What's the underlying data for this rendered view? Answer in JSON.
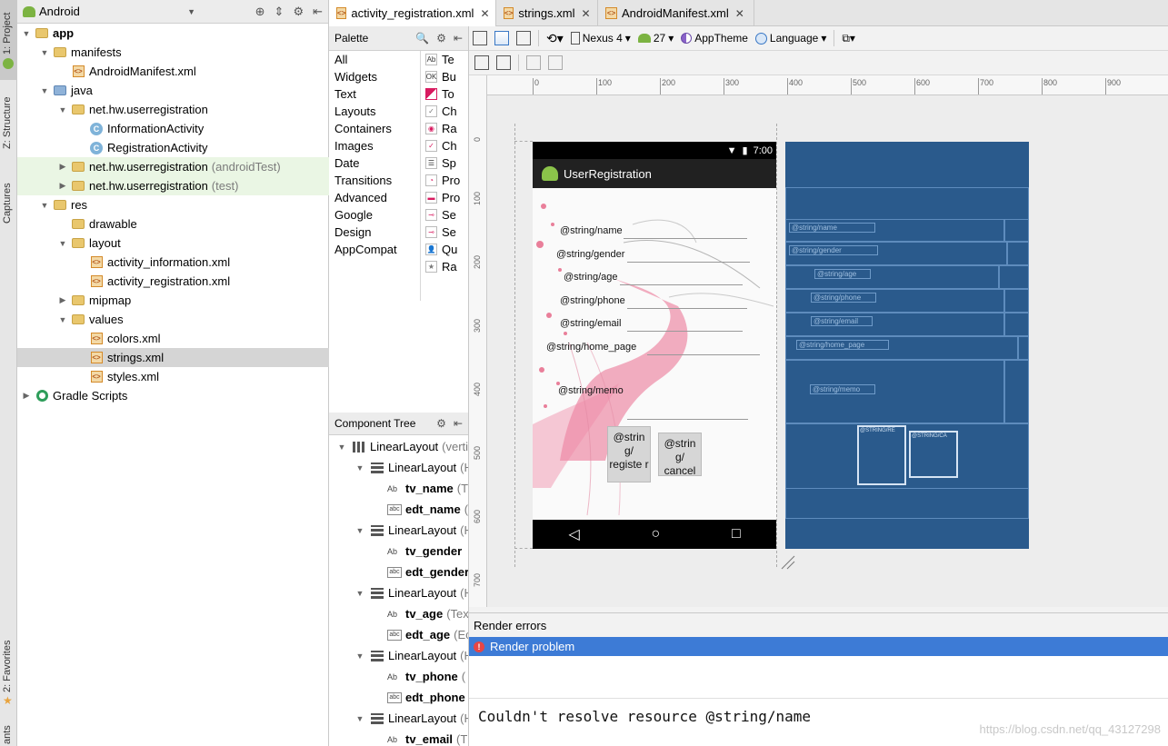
{
  "left_strip": {
    "project": "1: Project",
    "structure": "Z: Structure",
    "captures": "Captures",
    "favorites": "2: Favorites",
    "variants": "ants"
  },
  "project_panel": {
    "view_selector": "Android",
    "tree": [
      {
        "label": "app",
        "suffix": ""
      },
      {
        "label": "manifests",
        "suffix": ""
      },
      {
        "label": "AndroidManifest.xml",
        "suffix": ""
      },
      {
        "label": "java",
        "suffix": ""
      },
      {
        "label": "net.hw.userregistration",
        "suffix": ""
      },
      {
        "label": "InformationActivity",
        "suffix": ""
      },
      {
        "label": "RegistrationActivity",
        "suffix": ""
      },
      {
        "label": "net.hw.userregistration",
        "suffix": "(androidTest)"
      },
      {
        "label": "net.hw.userregistration",
        "suffix": "(test)"
      },
      {
        "label": "res",
        "suffix": ""
      },
      {
        "label": "drawable",
        "suffix": ""
      },
      {
        "label": "layout",
        "suffix": ""
      },
      {
        "label": "activity_information.xml",
        "suffix": ""
      },
      {
        "label": "activity_registration.xml",
        "suffix": ""
      },
      {
        "label": "mipmap",
        "suffix": ""
      },
      {
        "label": "values",
        "suffix": ""
      },
      {
        "label": "colors.xml",
        "suffix": ""
      },
      {
        "label": "strings.xml",
        "suffix": ""
      },
      {
        "label": "styles.xml",
        "suffix": ""
      },
      {
        "label": "Gradle Scripts",
        "suffix": ""
      }
    ]
  },
  "editor_tabs": [
    {
      "label": "activity_registration.xml"
    },
    {
      "label": "strings.xml"
    },
    {
      "label": "AndroidManifest.xml"
    }
  ],
  "palette": {
    "title": "Palette",
    "categories": [
      "All",
      "Widgets",
      "Text",
      "Layouts",
      "Containers",
      "Images",
      "Date",
      "Transitions",
      "Advanced",
      "Google",
      "Design",
      "AppCompat"
    ],
    "widgets": [
      "Te",
      "Bu",
      "To",
      "Ch",
      "Ra",
      "Ch",
      "Sp",
      "Pro",
      "Pro",
      "Se",
      "Se",
      "Qu",
      "Ra"
    ]
  },
  "component_tree": {
    "title": "Component Tree",
    "rows": [
      {
        "name": "LinearLayout",
        "hint": "(verti"
      },
      {
        "name": "LinearLayout",
        "hint": "(H"
      },
      {
        "name": "tv_name",
        "hint": "(T"
      },
      {
        "name": "edt_name",
        "hint": "("
      },
      {
        "name": "LinearLayout",
        "hint": "(H"
      },
      {
        "name": "tv_gender",
        "hint": ""
      },
      {
        "name": "edt_gender",
        "hint": ""
      },
      {
        "name": "LinearLayout",
        "hint": "(H"
      },
      {
        "name": "tv_age",
        "hint": "(Tex"
      },
      {
        "name": "edt_age",
        "hint": "(Ec"
      },
      {
        "name": "LinearLayout",
        "hint": "(H"
      },
      {
        "name": "tv_phone",
        "hint": "("
      },
      {
        "name": "edt_phone",
        "hint": ""
      },
      {
        "name": "LinearLayout",
        "hint": "(H"
      },
      {
        "name": "tv_email",
        "hint": "(T"
      }
    ]
  },
  "designer_toolbar": {
    "device": "Nexus 4",
    "api": "27",
    "theme": "AppTheme",
    "language": "Language"
  },
  "ruler": {
    "x_ticks": [
      "0",
      "100",
      "200",
      "300",
      "400",
      "500",
      "600",
      "700",
      "800",
      "900"
    ],
    "y_ticks": [
      "0",
      "100",
      "200",
      "300",
      "400",
      "500",
      "600",
      "700"
    ]
  },
  "phone": {
    "time": "7:00",
    "app_title": "UserRegistration",
    "labels": [
      "@string/name",
      "@string/gender",
      "@string/age",
      "@string/phone",
      "@string/email",
      "@string/home_page",
      "@string/memo"
    ],
    "register_button": "@strin g/ registe r",
    "cancel_button": "@strin g/ cancel"
  },
  "blueprint": {
    "labels": [
      "@string/name",
      "@string/gender",
      "@string/age",
      "@string/phone",
      "@string/email",
      "@string/home_page",
      "@string/memo"
    ],
    "btn1": "@STRING/RE",
    "btn2": "@STRING/CA"
  },
  "errors": {
    "title": "Render errors",
    "problem": "Render problem",
    "message": "Couldn't resolve resource @string/name",
    "watermark": "https://blog.csdn.net/qq_43127298"
  },
  "colors": {
    "selection_blue": "#3d7bd6",
    "blueprint": "#2a5a8c",
    "test_green": "#eaf6e4"
  }
}
